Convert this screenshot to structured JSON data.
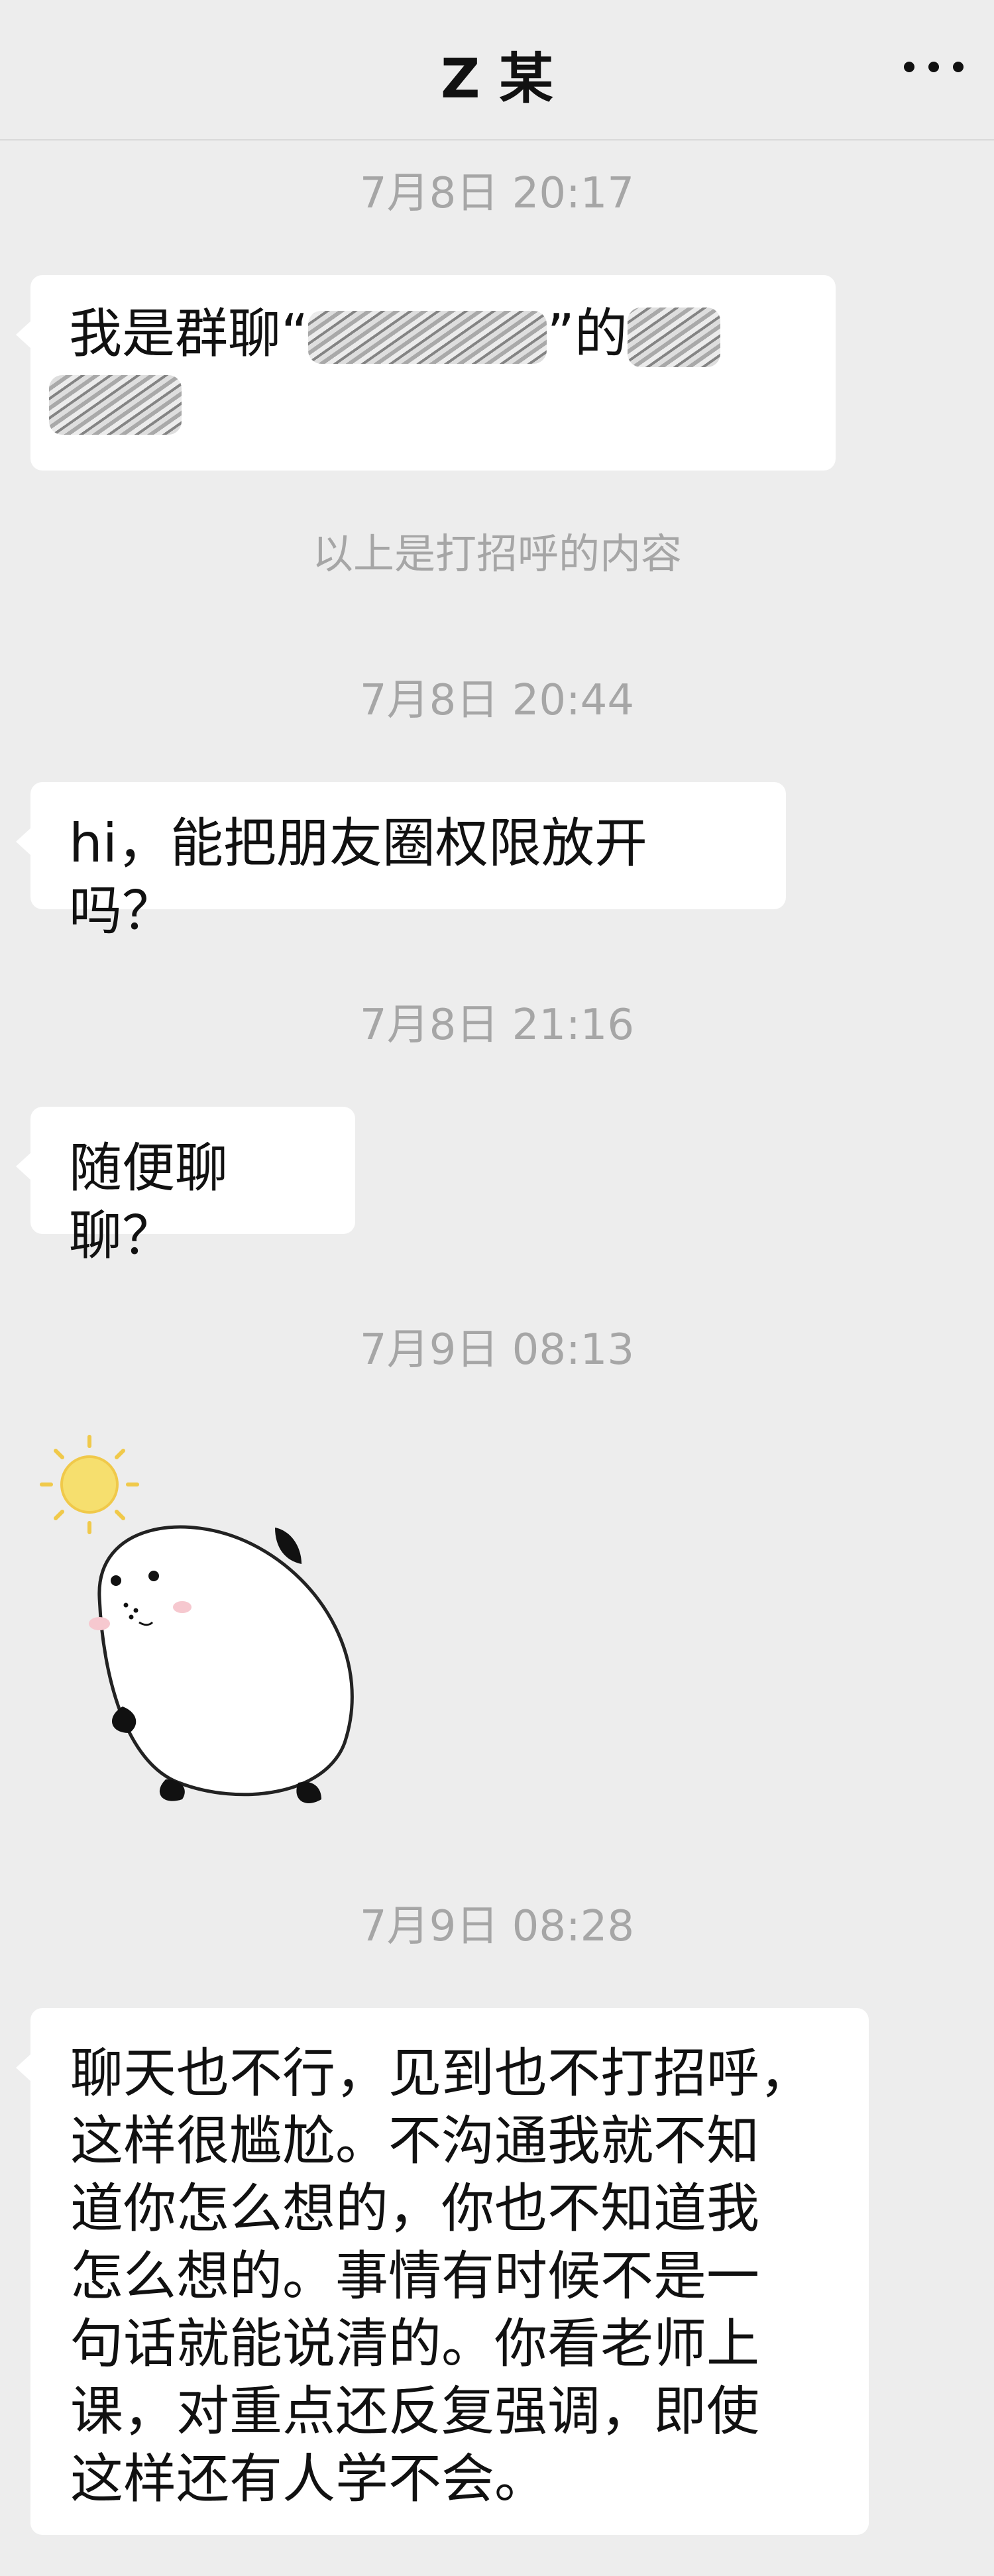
{
  "header": {
    "title": "Z 某",
    "more_icon": "more-dots-icon"
  },
  "messages": {
    "t1": "7月8日 20:17",
    "m1_prefix": "我是群聊“",
    "m1_suffix": "”的",
    "system_note": "以上是打招呼的内容",
    "t2": "7月8日 20:44",
    "m2": "hi，能把朋友圈权限放开吗？",
    "t3": "7月8日 21:16",
    "m3": "随便聊聊？",
    "t4": "7月9日 08:13",
    "sticker": "seal-with-sun-sticker",
    "t5": "7月9日 08:28",
    "m5": "聊天也不行，见到也不打招呼，\n这样很尴尬。不沟通我就不知\n道你怎么想的，你也不知道我\n怎么想的。事情有时候不是一\n句话就能说清的。你看老师上\n课，对重点还反复强调，即使\n这样还有人学不会。"
  },
  "colors": {
    "background": "#ededed",
    "bubble": "#ffffff",
    "timestamp": "#a6a6a6"
  }
}
